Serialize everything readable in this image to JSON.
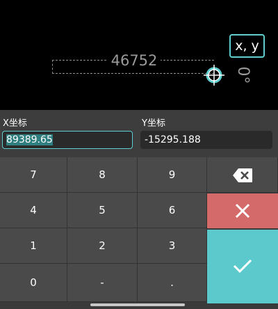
{
  "canvas": {
    "dimension_value": "46752",
    "angle_readout": "0°",
    "coord_mode_label": "x, y"
  },
  "inputs": {
    "x": {
      "label": "X坐标",
      "value": "89389.65"
    },
    "y": {
      "label": "Y坐标",
      "value": "-15295.188"
    }
  },
  "keypad": {
    "row1": [
      "7",
      "8",
      "9"
    ],
    "row2": [
      "4",
      "5",
      "6"
    ],
    "row3": [
      "1",
      "2",
      "3"
    ],
    "row4": [
      "0",
      "-",
      "."
    ]
  },
  "icons": {
    "delete": "backspace-icon",
    "clear": "close-icon",
    "confirm": "check-icon"
  },
  "colors": {
    "accent": "#5ecfd1",
    "clear_key": "#d46a6a",
    "confirm_key": "#5cc9cc"
  }
}
